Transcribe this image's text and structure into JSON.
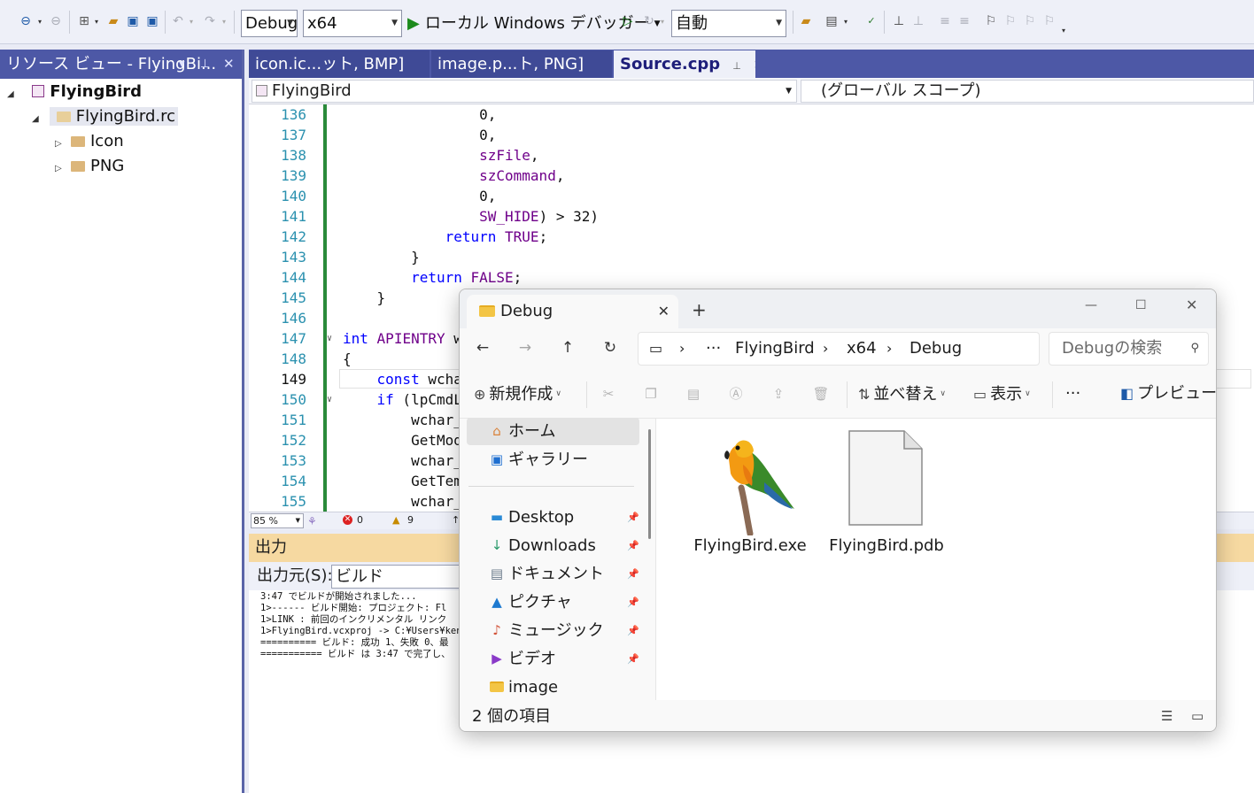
{
  "toolbar": {
    "config_combo": "Debug",
    "platform_combo": "x64",
    "debugger_label": "ローカル Windows デバッガー",
    "auto_combo": "自動"
  },
  "resource_view": {
    "title": "リソース ビュー - FlyingBi...",
    "root": "FlyingBird",
    "rc_file": "FlyingBird.rc",
    "folders": [
      "Icon",
      "PNG"
    ]
  },
  "editor": {
    "tabs": [
      {
        "label": "icon.ic...ット, BMP]"
      },
      {
        "label": "image.p...ト, PNG]"
      },
      {
        "label": "Source.cpp"
      }
    ],
    "scope_left": "FlyingBird",
    "scope_right": "(グローバル スコープ)",
    "current_line": 149,
    "lines": [
      {
        "n": "136",
        "code": "                0,"
      },
      {
        "n": "137",
        "code": "                0,"
      },
      {
        "n": "138",
        "code": "                szFile,"
      },
      {
        "n": "139",
        "code": "                szCommand,"
      },
      {
        "n": "140",
        "code": "                0,"
      },
      {
        "n": "141",
        "code": "                SW_HIDE) > 32)"
      },
      {
        "n": "142",
        "code": "            return TRUE;"
      },
      {
        "n": "143",
        "code": "        }"
      },
      {
        "n": "144",
        "code": "        return FALSE;"
      },
      {
        "n": "145",
        "code": "    }"
      },
      {
        "n": "146",
        "code": ""
      },
      {
        "n": "147",
        "code": "int APIENTRY w"
      },
      {
        "n": "148",
        "code": "{"
      },
      {
        "n": "149",
        "code": "    const wcha"
      },
      {
        "n": "150",
        "code": "    if (lpCmdL"
      },
      {
        "n": "151",
        "code": "        wchar_"
      },
      {
        "n": "152",
        "code": "        GetMod"
      },
      {
        "n": "153",
        "code": "        wchar_"
      },
      {
        "n": "154",
        "code": "        GetTem"
      },
      {
        "n": "155",
        "code": "        wchar_"
      }
    ],
    "status": {
      "zoom": "85 %",
      "errors": "0",
      "warnings": "9"
    }
  },
  "output": {
    "title": "出力",
    "source_label": "出力元(S):",
    "source_value": "ビルド",
    "lines": [
      "3:47 でビルドが開始されました...",
      "1>------ ビルド開始: プロジェクト: Fl",
      "1>LINK : 前回のインクリメンタル リンク",
      "1>FlyingBird.vcxproj -> C:¥Users¥kenj",
      "========== ビルド: 成功 1、失敗 0、最",
      "=========== ビルド は 3:47 で完了し、"
    ]
  },
  "explorer": {
    "tab_title": "Debug",
    "breadcrumb": [
      "FlyingBird",
      "x64",
      "Debug"
    ],
    "search_placeholder": "Debugの検索",
    "commands": {
      "new": "新規作成",
      "sort": "並べ替え",
      "view": "表示",
      "more": "···",
      "preview": "プレビュー"
    },
    "nav_items": [
      {
        "label": "ホーム",
        "icon": "home-icon"
      },
      {
        "label": "ギャラリー",
        "icon": "gallery-icon"
      },
      {
        "label": "Desktop",
        "icon": "desktop-icon"
      },
      {
        "label": "Downloads",
        "icon": "download-icon"
      },
      {
        "label": "ドキュメント",
        "icon": "document-icon"
      },
      {
        "label": "ピクチャ",
        "icon": "pictures-icon"
      },
      {
        "label": "ミュージック",
        "icon": "music-icon"
      },
      {
        "label": "ビデオ",
        "icon": "video-icon"
      },
      {
        "label": "image",
        "icon": "folder-icon"
      }
    ],
    "files": [
      {
        "name": "FlyingBird.exe",
        "icon": "parrot-app-icon"
      },
      {
        "name": "FlyingBird.pdb",
        "icon": "blank-file-icon"
      }
    ],
    "status": "2 個の項目",
    "colors": {
      "folder": "#f3c545",
      "accent": "#1e5aa8"
    }
  }
}
